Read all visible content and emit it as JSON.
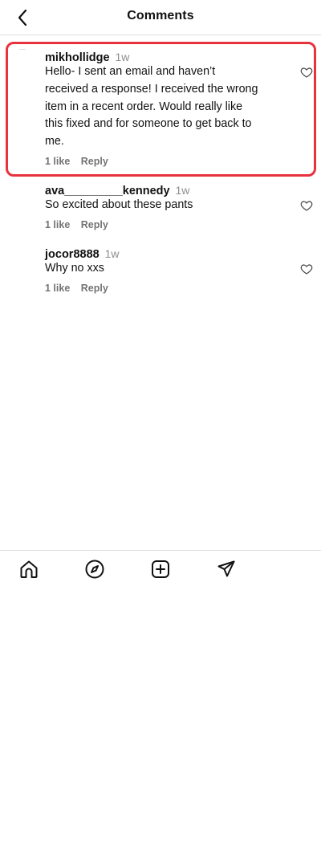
{
  "header": {
    "title": "Comments",
    "back_icon": "chevron-left-icon"
  },
  "comments": [
    {
      "username": "mikhollidge",
      "time": "1w",
      "text_lines": [
        "Hello- I sent an email and haven’t",
        "received a response! I received the wrong",
        "item in a recent order. Would really like",
        "this fixed and for someone to get back to",
        "me."
      ],
      "likes": "1 like",
      "reply_label": "Reply",
      "highlighted": true
    },
    {
      "username": "ava_________kennedy",
      "time": "1w",
      "text_lines": [
        "So excited about these pants"
      ],
      "likes": "1 like",
      "reply_label": "Reply"
    },
    {
      "username": "jocor8888",
      "time": "1w",
      "text_lines": [
        "Why no xxs"
      ],
      "likes": "1 like",
      "reply_label": "Reply"
    }
  ],
  "tabbar": {
    "items": [
      "home-icon",
      "compass-icon",
      "create-icon",
      "send-icon"
    ]
  },
  "colors": {
    "highlight": "#e8323e",
    "muted": "#737373",
    "divider": "#dbdbdb"
  }
}
